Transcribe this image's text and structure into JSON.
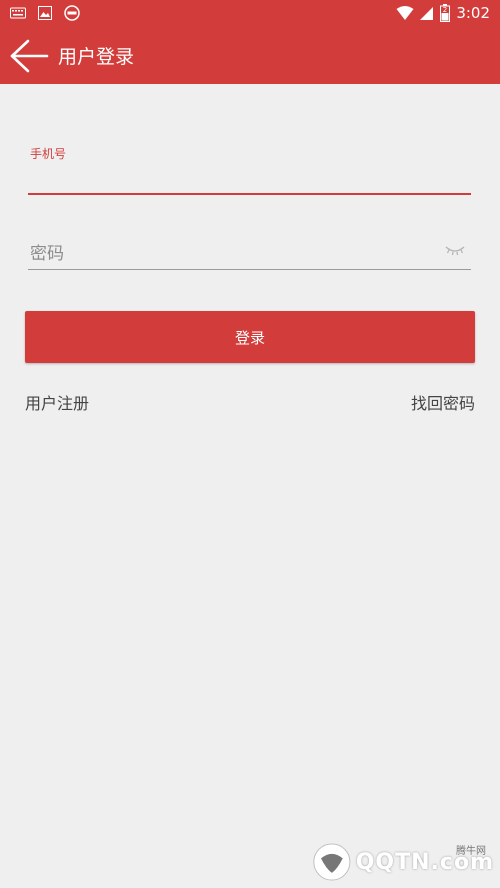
{
  "status_bar": {
    "time": "3:02",
    "battery_level": "2",
    "left_icons": [
      "keyboard-icon",
      "image-icon",
      "app-badge-icon"
    ],
    "right_icons": [
      "wifi-icon",
      "signal-icon",
      "battery-icon"
    ]
  },
  "app_bar": {
    "title": "用户登录",
    "back_icon": "arrow-left-icon"
  },
  "form": {
    "phone_label": "手机号",
    "phone_value": "",
    "password_placeholder": "密码",
    "password_value": "",
    "password_toggle_icon": "eye-closed-icon",
    "login_button_label": "登录"
  },
  "links": {
    "register": "用户注册",
    "forgot_password": "找回密码"
  },
  "watermark": {
    "brand": "QQTN.com",
    "sub": "腾牛网"
  },
  "colors": {
    "primary": "#d23d3c",
    "background": "#efefef",
    "text_link": "#444444"
  }
}
